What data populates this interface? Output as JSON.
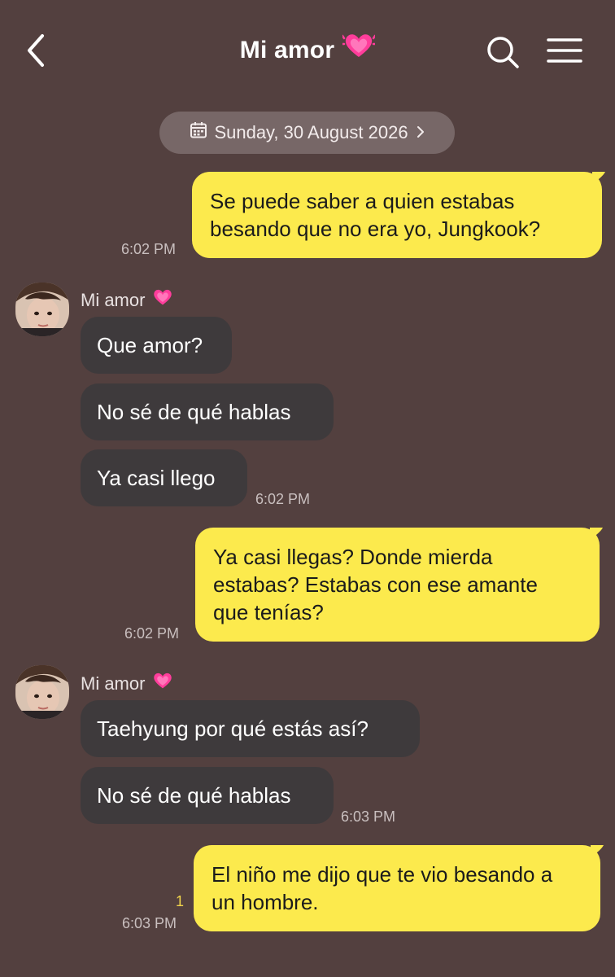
{
  "header": {
    "title": "Mi amor",
    "title_emoji": "heart-emoji"
  },
  "date_chip": {
    "label": "Sunday, 30 August 2026"
  },
  "messages": [
    {
      "from": "me",
      "text": "Se puede saber a quien estabas besando que no era yo, Jungkook?",
      "time": "6:02 PM"
    },
    {
      "from": "Mi amor",
      "sender_label": "Mi amor",
      "bubbles": [
        "Que amor?",
        "No sé de qué hablas",
        "Ya casi llego"
      ],
      "time": "6:02 PM"
    },
    {
      "from": "me",
      "text": "Ya casi llegas? Donde mierda estabas? Estabas con ese amante que tenías?",
      "time": "6:02 PM"
    },
    {
      "from": "Mi amor",
      "sender_label": "Mi amor",
      "bubbles": [
        "Taehyung por qué estás así?",
        "No sé de qué hablas"
      ],
      "time": "6:03 PM"
    },
    {
      "from": "me",
      "text": "El niño me dijo que te vio besando a un hombre.",
      "time": "6:03 PM",
      "unread_count": "1"
    }
  ],
  "colors": {
    "background": "#53403f",
    "outgoing_bubble": "#fcea4d",
    "incoming_bubble": "#3e3a3c",
    "date_chip": "#776767",
    "heart": "#ff3d9b"
  },
  "icons": [
    "back-icon",
    "search-icon",
    "menu-icon",
    "calendar-icon",
    "chevron-right-icon",
    "heart-emoji"
  ]
}
